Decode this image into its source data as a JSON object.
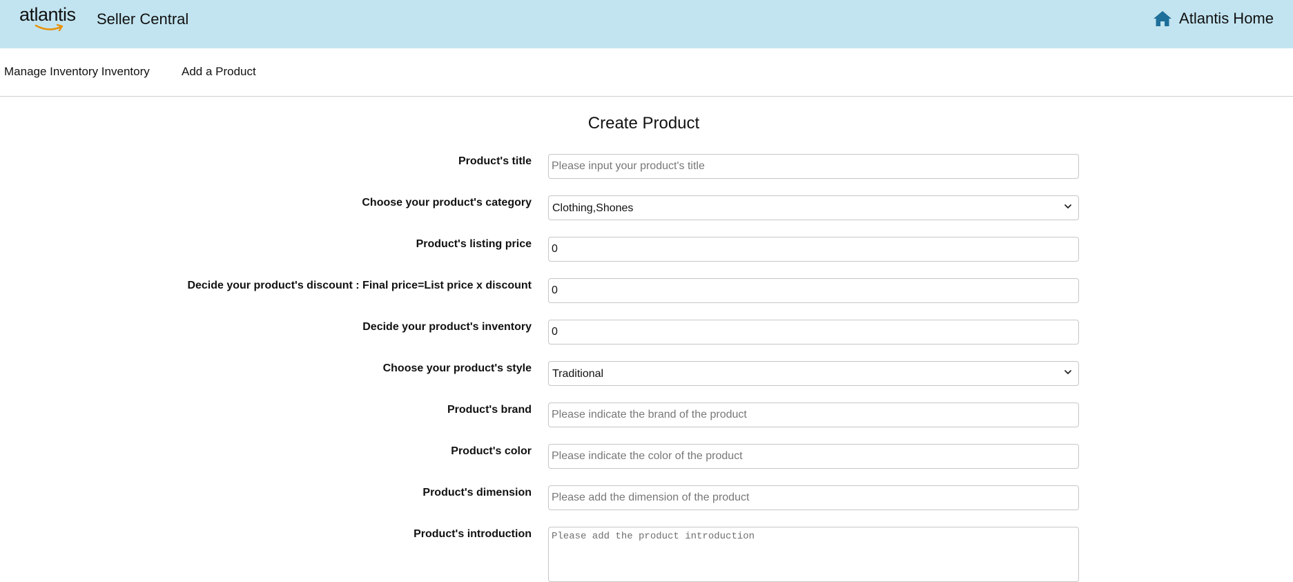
{
  "header": {
    "logo_text": "atlantis",
    "app_title": "Seller Central",
    "home_label": "Atlantis Home",
    "home_icon": "home-icon",
    "accent_color": "#1e6f9a",
    "background_color": "#c2e4f0"
  },
  "nav": {
    "items": [
      {
        "label": "Manage Inventory Inventory"
      },
      {
        "label": "Add a Product"
      }
    ]
  },
  "form": {
    "title": "Create Product",
    "fields": {
      "title": {
        "label": "Product's title",
        "value": "",
        "placeholder": "Please input your product's title"
      },
      "category": {
        "label": "Choose your product's category",
        "value": "Clothing,Shones"
      },
      "listing_price": {
        "label": "Product's listing price",
        "value": "0"
      },
      "discount": {
        "label": "Decide your product's discount : Final price=List price x discount",
        "value": "0"
      },
      "inventory": {
        "label": "Decide your product's inventory",
        "value": "0"
      },
      "style": {
        "label": "Choose your product's style",
        "value": "Traditional"
      },
      "brand": {
        "label": "Product's brand",
        "value": "",
        "placeholder": "Please indicate the brand of the product"
      },
      "color": {
        "label": "Product's color",
        "value": "",
        "placeholder": "Please indicate the color of the product"
      },
      "dimension": {
        "label": "Product's dimension",
        "value": "",
        "placeholder": "Please add the dimension of the product"
      },
      "introduction": {
        "label": "Product's introduction",
        "value": "",
        "placeholder": "Please add the product introduction"
      }
    }
  }
}
